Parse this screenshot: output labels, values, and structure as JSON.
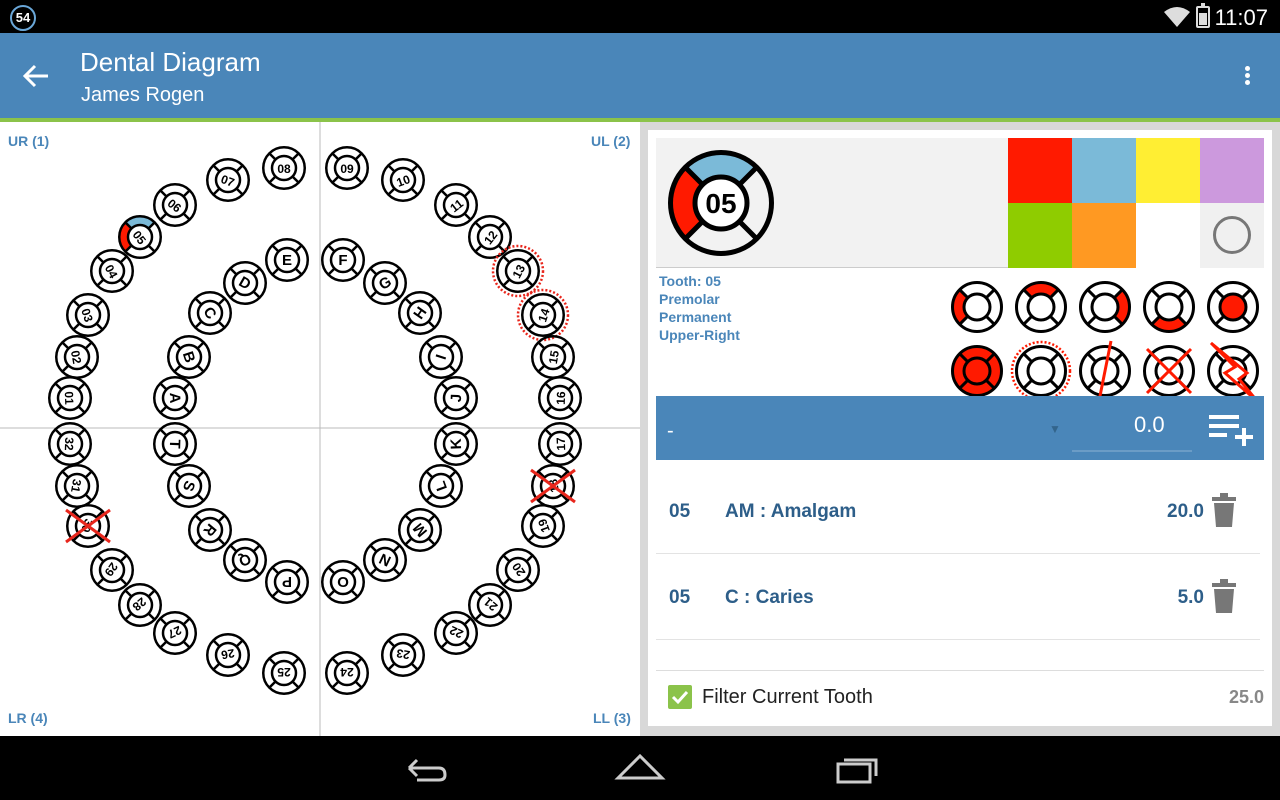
{
  "status_bar": {
    "badge": "54",
    "time": "11:07"
  },
  "app_bar": {
    "title": "Dental Diagram",
    "subtitle": "James Rogen"
  },
  "colors": {
    "app_bar": "#4a86b9",
    "accent": "#8bc34a",
    "label": "#4a86b9"
  },
  "diagram": {
    "quadrants": {
      "ur": "UR (1)",
      "ul": "UL (2)",
      "ll": "LL (3)",
      "lr": "LR (4)"
    },
    "teeth": [
      {
        "id": "08",
        "label": "08",
        "rot": 0,
        "marks": []
      },
      {
        "id": "07",
        "label": "07",
        "rot": 20,
        "marks": []
      },
      {
        "id": "06",
        "label": "06",
        "rot": 38,
        "marks": []
      },
      {
        "id": "05",
        "label": "05",
        "rot": 52,
        "marks": [
          {
            "surface": "top",
            "color": "#7bbad8"
          },
          {
            "surface": "left",
            "color": "#ff1a00"
          }
        ]
      },
      {
        "id": "04",
        "label": "04",
        "rot": 62,
        "marks": []
      },
      {
        "id": "03",
        "label": "03",
        "rot": 72,
        "marks": []
      },
      {
        "id": "02",
        "label": "02",
        "rot": 80,
        "marks": []
      },
      {
        "id": "01",
        "label": "01",
        "rot": 88,
        "marks": []
      },
      {
        "id": "E",
        "label": "E",
        "rot": 0,
        "marks": []
      },
      {
        "id": "D",
        "label": "D",
        "rot": 30,
        "marks": []
      },
      {
        "id": "C",
        "label": "C",
        "rot": 55,
        "marks": []
      },
      {
        "id": "B",
        "label": "B",
        "rot": 72,
        "marks": []
      },
      {
        "id": "A",
        "label": "A",
        "rot": 88,
        "marks": []
      },
      {
        "id": "09",
        "label": "09",
        "rot": 0,
        "marks": []
      },
      {
        "id": "10",
        "label": "10",
        "rot": -20,
        "marks": []
      },
      {
        "id": "11",
        "label": "11",
        "rot": -38,
        "marks": []
      },
      {
        "id": "12",
        "label": "12",
        "rot": -52,
        "marks": []
      },
      {
        "id": "13",
        "label": "13",
        "rot": -62,
        "marks": [],
        "ring": true
      },
      {
        "id": "14",
        "label": "14",
        "rot": -72,
        "marks": [],
        "ring": true
      },
      {
        "id": "15",
        "label": "15",
        "rot": -80,
        "marks": []
      },
      {
        "id": "16",
        "label": "16",
        "rot": -88,
        "marks": []
      },
      {
        "id": "F",
        "label": "F",
        "rot": 0,
        "marks": []
      },
      {
        "id": "G",
        "label": "G",
        "rot": -30,
        "marks": []
      },
      {
        "id": "H",
        "label": "H",
        "rot": -55,
        "marks": []
      },
      {
        "id": "I",
        "label": "I",
        "rot": -72,
        "marks": []
      },
      {
        "id": "J",
        "label": "J",
        "rot": -88,
        "marks": []
      },
      {
        "id": "32",
        "label": "32",
        "rot": 92,
        "marks": []
      },
      {
        "id": "31",
        "label": "31",
        "rot": 100,
        "marks": []
      },
      {
        "id": "30",
        "label": "30",
        "rot": 110,
        "marks": [],
        "cross": true
      },
      {
        "id": "29",
        "label": "29",
        "rot": 125,
        "marks": []
      },
      {
        "id": "28",
        "label": "28",
        "rot": 140,
        "marks": []
      },
      {
        "id": "27",
        "label": "27",
        "rot": 155,
        "marks": []
      },
      {
        "id": "26",
        "label": "26",
        "rot": 170,
        "marks": []
      },
      {
        "id": "25",
        "label": "25",
        "rot": 180,
        "marks": []
      },
      {
        "id": "T",
        "label": "T",
        "rot": 92,
        "marks": []
      },
      {
        "id": "S",
        "label": "S",
        "rot": 110,
        "marks": []
      },
      {
        "id": "R",
        "label": "R",
        "rot": 130,
        "marks": []
      },
      {
        "id": "Q",
        "label": "Q",
        "rot": 155,
        "marks": []
      },
      {
        "id": "P",
        "label": "P",
        "rot": 180,
        "marks": []
      },
      {
        "id": "17",
        "label": "17",
        "rot": -92,
        "marks": []
      },
      {
        "id": "18",
        "label": "18",
        "rot": -100,
        "marks": [],
        "cross": true
      },
      {
        "id": "19",
        "label": "19",
        "rot": -110,
        "marks": []
      },
      {
        "id": "20",
        "label": "20",
        "rot": -125,
        "marks": []
      },
      {
        "id": "21",
        "label": "21",
        "rot": -140,
        "marks": []
      },
      {
        "id": "22",
        "label": "22",
        "rot": -155,
        "marks": []
      },
      {
        "id": "23",
        "label": "23",
        "rot": -170,
        "marks": []
      },
      {
        "id": "24",
        "label": "24",
        "rot": -180,
        "marks": []
      },
      {
        "id": "K",
        "label": "K",
        "rot": -92,
        "marks": []
      },
      {
        "id": "L",
        "label": "L",
        "rot": -110,
        "marks": []
      },
      {
        "id": "M",
        "label": "M",
        "rot": -130,
        "marks": []
      },
      {
        "id": "N",
        "label": "N",
        "rot": -155,
        "marks": []
      },
      {
        "id": "O",
        "label": "O",
        "rot": -180,
        "marks": []
      }
    ]
  },
  "editor": {
    "preview": {
      "label": "05",
      "marks": [
        {
          "surface": "top",
          "color": "#7bbad8"
        },
        {
          "surface": "left",
          "color": "#ff1a00"
        }
      ]
    },
    "palette": [
      {
        "name": "red",
        "color": "#ff1a00"
      },
      {
        "name": "light-blue",
        "color": "#7bbad8"
      },
      {
        "name": "yellow",
        "color": "#ffee33"
      },
      {
        "name": "lavender",
        "color": "#cc99dd"
      },
      {
        "name": "green",
        "color": "#8fcc00"
      },
      {
        "name": "orange",
        "color": "#ff9922"
      },
      {
        "name": "white",
        "color": "#ffffff"
      },
      {
        "name": "clear",
        "color": "#f0f0f0",
        "icon": "circle-outline-icon"
      }
    ],
    "info": [
      "Tooth: 05",
      "Premolar",
      "Permanent",
      "Upper-Right"
    ],
    "tools": [
      {
        "name": "left-surface-tool",
        "fill": [
          "left"
        ],
        "style": "normal"
      },
      {
        "name": "top-surface-tool",
        "fill": [
          "top"
        ],
        "style": "normal"
      },
      {
        "name": "right-surface-tool",
        "fill": [
          "right"
        ],
        "style": "normal"
      },
      {
        "name": "bottom-surface-tool",
        "fill": [
          "bottom"
        ],
        "style": "normal"
      },
      {
        "name": "center-surface-tool",
        "fill": [
          "center"
        ],
        "style": "normal"
      },
      {
        "name": "all-surfaces-tool",
        "fill": [
          "left",
          "top",
          "right",
          "bottom",
          "center"
        ],
        "style": "normal"
      },
      {
        "name": "dotted-ring-tool",
        "fill": [],
        "style": "ring"
      },
      {
        "name": "fracture-line-tool",
        "fill": [],
        "style": "line"
      },
      {
        "name": "extraction-cross-tool",
        "fill": [],
        "style": "cross"
      },
      {
        "name": "lightning-tool",
        "fill": [],
        "style": "bolt"
      }
    ],
    "tool_color": "#ff1a00",
    "entry": {
      "dash": "-",
      "value": "0.0"
    },
    "procedures": [
      {
        "tooth": "05",
        "desc": "AM : Amalgam",
        "amount": "20.0"
      },
      {
        "tooth": "05",
        "desc": "C : Caries",
        "amount": "5.0"
      }
    ],
    "filter": {
      "label": "Filter Current Tooth",
      "checked": true,
      "total": "25.0"
    }
  }
}
